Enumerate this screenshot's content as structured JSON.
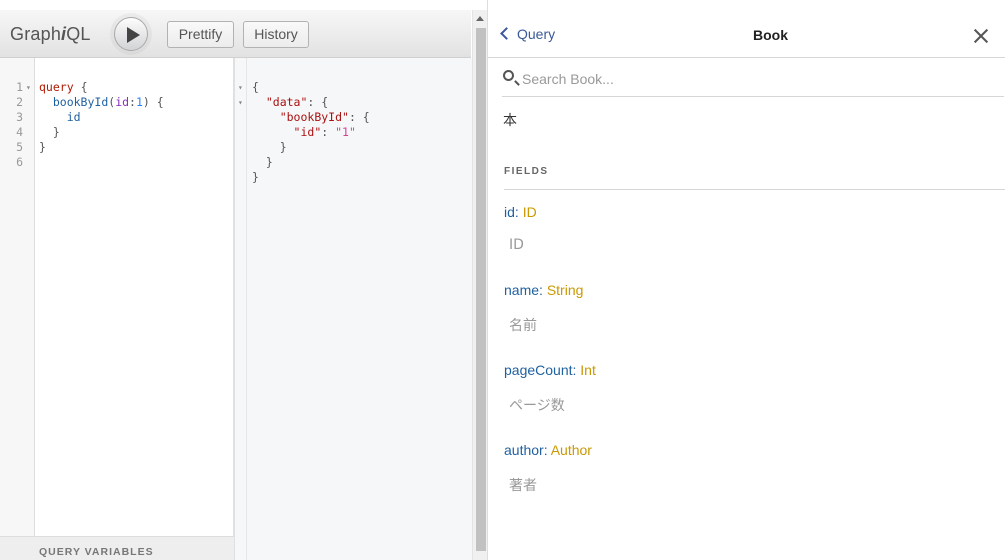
{
  "toolbar": {
    "logo_prefix": "Graph",
    "logo_i": "i",
    "logo_suffix": "QL",
    "prettify_label": "Prettify",
    "history_label": "History"
  },
  "editor": {
    "line_numbers": [
      "1",
      "2",
      "3",
      "4",
      "5",
      "6"
    ],
    "query_variables_label": "QUERY VARIABLES"
  },
  "doc_explorer": {
    "back_label": "Query",
    "title": "Book",
    "search_placeholder": "Search Book...",
    "type_description": "本",
    "fields_title": "FIELDS",
    "fields": [
      {
        "name": "id",
        "type": "ID",
        "description": "ID"
      },
      {
        "name": "name",
        "type": "String",
        "description": "名前"
      },
      {
        "name": "pageCount",
        "type": "Int",
        "description": "ページ数"
      },
      {
        "name": "author",
        "type": "Author",
        "description": "著者"
      }
    ]
  },
  "icons": {
    "run": "play-icon",
    "back": "chevron-left-icon",
    "close": "close-icon",
    "search": "search-icon"
  }
}
